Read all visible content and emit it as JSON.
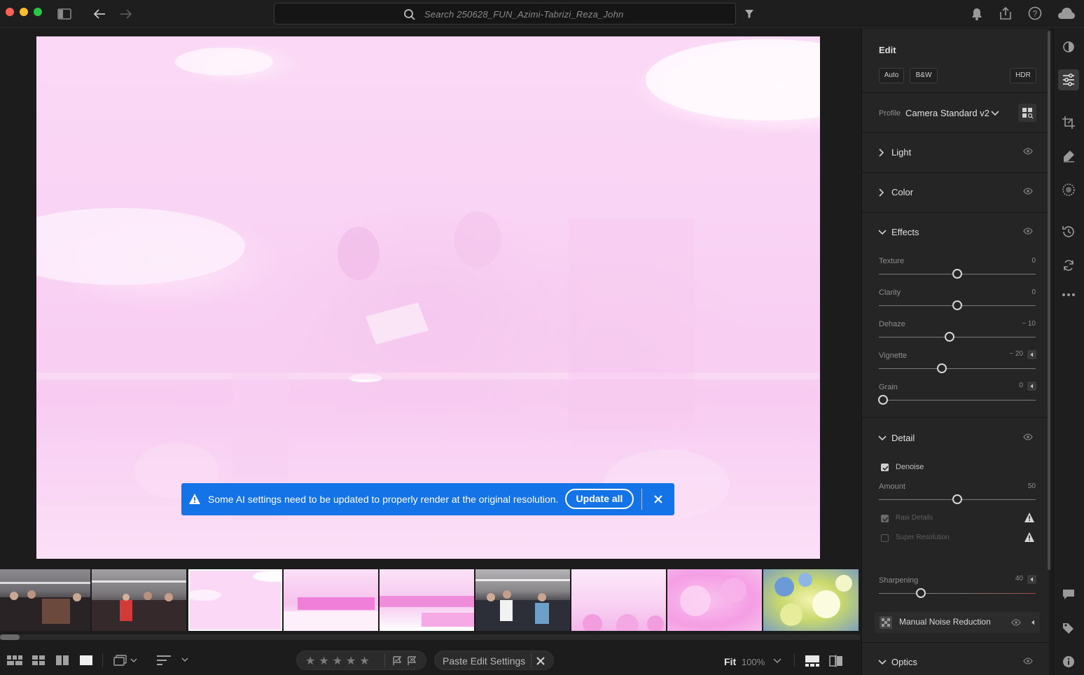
{
  "toolbar": {
    "search_placeholder": "Search 250628_FUN_Azimi-Tabrizi_Reza_John"
  },
  "icons": {
    "traffic_lights": [
      "close-window",
      "minimize-window",
      "zoom-window"
    ],
    "top_left": [
      "sidebar-toggle-icon",
      "back-arrow-icon",
      "forward-arrow-icon"
    ],
    "top_right": [
      "bell-icon",
      "share-icon",
      "help-icon",
      "cloud-icon"
    ],
    "rail": [
      "presets-icon",
      "edit-sliders-icon",
      "crop-icon",
      "healing-icon",
      "masking-icon",
      "versions-icon",
      "remix-icon",
      "more-icon",
      "comments-icon",
      "keywords-icon",
      "info-icon"
    ]
  },
  "colors": {
    "accent": "#1473e6",
    "photo_tint": "#f8ccf2",
    "traffic_red": "#ff5f57",
    "traffic_yellow": "#febc2e",
    "traffic_green": "#28c840"
  },
  "banner": {
    "message": "Some AI settings need to be updated to properly render at the original resolution.",
    "button_label": "Update all"
  },
  "edit_panel": {
    "title": "Edit",
    "buttons": {
      "auto": "Auto",
      "bw": "B&W",
      "hdr": "HDR"
    },
    "profile": {
      "label": "Profile",
      "value": "Camera Standard v2"
    },
    "sections": {
      "light": "Light",
      "color": "Color",
      "effects": "Effects",
      "detail": "Detail",
      "optics": "Optics"
    },
    "effects": [
      {
        "label": "Texture",
        "value": "0",
        "level": 0.5
      },
      {
        "label": "Clarity",
        "value": "0",
        "level": 0.5
      },
      {
        "label": "Dehaze",
        "value": "− 10",
        "level": 0.45
      },
      {
        "label": "Vignette",
        "value": "− 20",
        "level": 0.4
      },
      {
        "label": "Grain",
        "value": "0",
        "level": 0.0
      }
    ],
    "detail": {
      "denoise_label": "Denoise",
      "amount_label": "Amount",
      "amount_value": "50",
      "amount_level": 0.5,
      "raw_details_label": "Raw Details",
      "super_resolution_label": "Super Resolution",
      "sharpening_label": "Sharpening",
      "sharpening_value": "40",
      "sharpening_level": 0.27,
      "manual_noise_label": "Manual Noise Reduction"
    }
  },
  "bottom_bar": {
    "paste_label": "Paste Edit Settings",
    "zoom_fit": "Fit",
    "zoom_percent": "100%",
    "stars": "★★★★★"
  },
  "filmstrip": {
    "selected_index": 2,
    "thumbnails": [
      "event-room-group",
      "event-room-group-2",
      "pink-overexposed",
      "pink-overexposed-2",
      "pink-overexposed-3",
      "event-room-crowd",
      "pink-overexposed-4",
      "pink-flowers",
      "flower-bouquet"
    ]
  }
}
